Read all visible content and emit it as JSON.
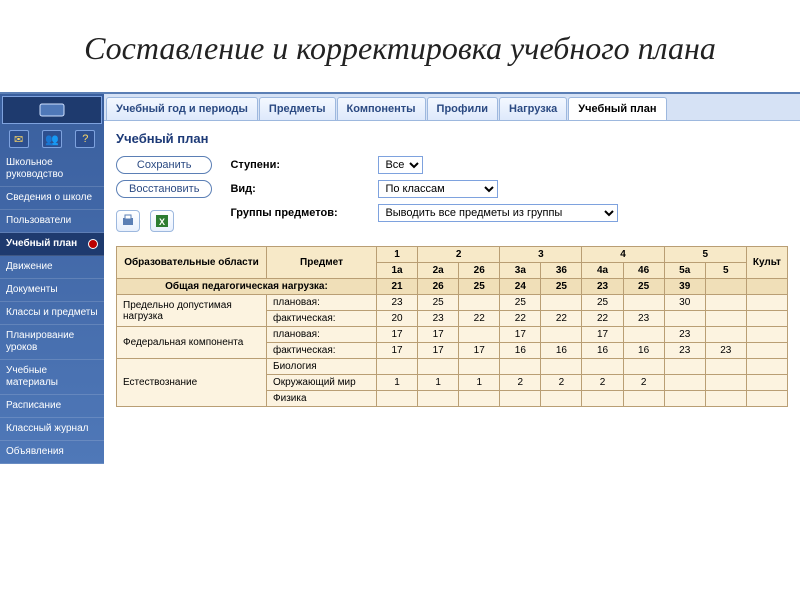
{
  "title": "Составление и корректировка учебного плана",
  "sidebar_icons": [
    "✉",
    "👥",
    "?"
  ],
  "sidebar": [
    {
      "label": "Школьное руководство"
    },
    {
      "label": "Сведения о школе"
    },
    {
      "label": "Пользователи"
    },
    {
      "label": "Учебный план",
      "active": true
    },
    {
      "label": "Движение"
    },
    {
      "label": "Документы"
    },
    {
      "label": "Классы и предметы"
    },
    {
      "label": "Планирование уроков"
    },
    {
      "label": "Учебные материалы"
    },
    {
      "label": "Расписание"
    },
    {
      "label": "Классный журнал"
    },
    {
      "label": "Объявления"
    }
  ],
  "tabs": [
    {
      "label": "Учебный год и периоды"
    },
    {
      "label": "Предметы"
    },
    {
      "label": "Компоненты"
    },
    {
      "label": "Профили"
    },
    {
      "label": "Нагрузка"
    },
    {
      "label": "Учебный план",
      "active": true
    }
  ],
  "section_title": "Учебный план",
  "buttons": {
    "save": "Сохранить",
    "restore": "Восстановить"
  },
  "filters": {
    "stupeni_label": "Ступени:",
    "stupeni_value": "Все",
    "vid_label": "Вид:",
    "vid_value": "По классам",
    "groups_label": "Группы предметов:",
    "groups_value": "Выводить все предметы из группы"
  },
  "table": {
    "hdr_area": "Образовательные области",
    "hdr_subject": "Предмет",
    "grades": [
      "1",
      "2",
      "3",
      "4",
      "5"
    ],
    "grade5_extra": "Культ",
    "subcols": [
      "1а",
      "2а",
      "26",
      "3а",
      "36",
      "4а",
      "46",
      "5а",
      "5"
    ],
    "rows": [
      {
        "type": "section",
        "label": "Общая педагогическая нагрузка:",
        "vals": [
          "21",
          "26",
          "25",
          "24",
          "25",
          "23",
          "25",
          "39",
          ""
        ]
      },
      {
        "type": "group",
        "area": "Предельно допустимая нагрузка",
        "sub": [
          {
            "label": "плановая:",
            "vals": [
              "23",
              "25",
              "",
              "25",
              "",
              "25",
              "",
              "30",
              ""
            ]
          },
          {
            "label": "фактическая:",
            "vals": [
              "20",
              "23",
              "22",
              "22",
              "22",
              "22",
              "23",
              "",
              ""
            ]
          }
        ]
      },
      {
        "type": "group",
        "area": "Федеральная компонента",
        "sub": [
          {
            "label": "плановая:",
            "vals": [
              "17",
              "17",
              "",
              "17",
              "",
              "17",
              "",
              "23",
              ""
            ]
          },
          {
            "label": "фактическая:",
            "vals": [
              "17",
              "17",
              "17",
              "16",
              "16",
              "16",
              "16",
              "23",
              "23"
            ]
          }
        ]
      },
      {
        "type": "group",
        "area": "Естествознание",
        "sub": [
          {
            "label": "Биология",
            "vals": [
              "",
              "",
              "",
              "",
              "",
              "",
              "",
              "",
              ""
            ]
          },
          {
            "label": "Окружающий мир",
            "vals": [
              "1",
              "1",
              "1",
              "2",
              "2",
              "2",
              "2",
              "",
              ""
            ]
          },
          {
            "label": "Физика",
            "vals": [
              "",
              "",
              "",
              "",
              "",
              "",
              "",
              "",
              ""
            ]
          }
        ]
      }
    ]
  }
}
